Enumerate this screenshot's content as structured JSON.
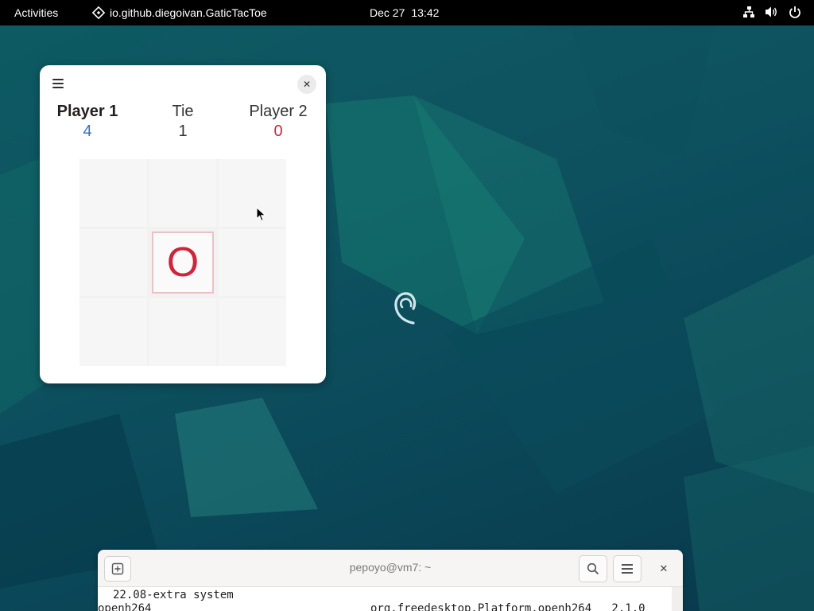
{
  "topbar": {
    "activities": "Activities",
    "app_name": "io.github.diegoivan.GaticTacToe",
    "date": "Dec 27",
    "time": "13:42",
    "status_icons": [
      "network-icon",
      "volume-icon",
      "power-icon"
    ]
  },
  "game": {
    "scores": {
      "player1": {
        "name": "Player 1",
        "value": "4"
      },
      "tie": {
        "name": "Tie",
        "value": "1"
      },
      "player2": {
        "name": "Player 2",
        "value": "0"
      }
    },
    "board": [
      "",
      "",
      "",
      "",
      "O",
      "",
      "",
      "",
      ""
    ],
    "colors": {
      "player1": "#3a6fbf",
      "player2": "#d0243b",
      "mark_o": "#d0243b"
    }
  },
  "terminal": {
    "title": "pepoyo@vm7: ~",
    "lines": {
      "line1": "22.08-extra system",
      "line2_left": "openh264",
      "line2_right": "org.freedesktop.Platform.openh264   2.1.0"
    }
  },
  "desktop": {
    "accent": "#0d5b63"
  }
}
